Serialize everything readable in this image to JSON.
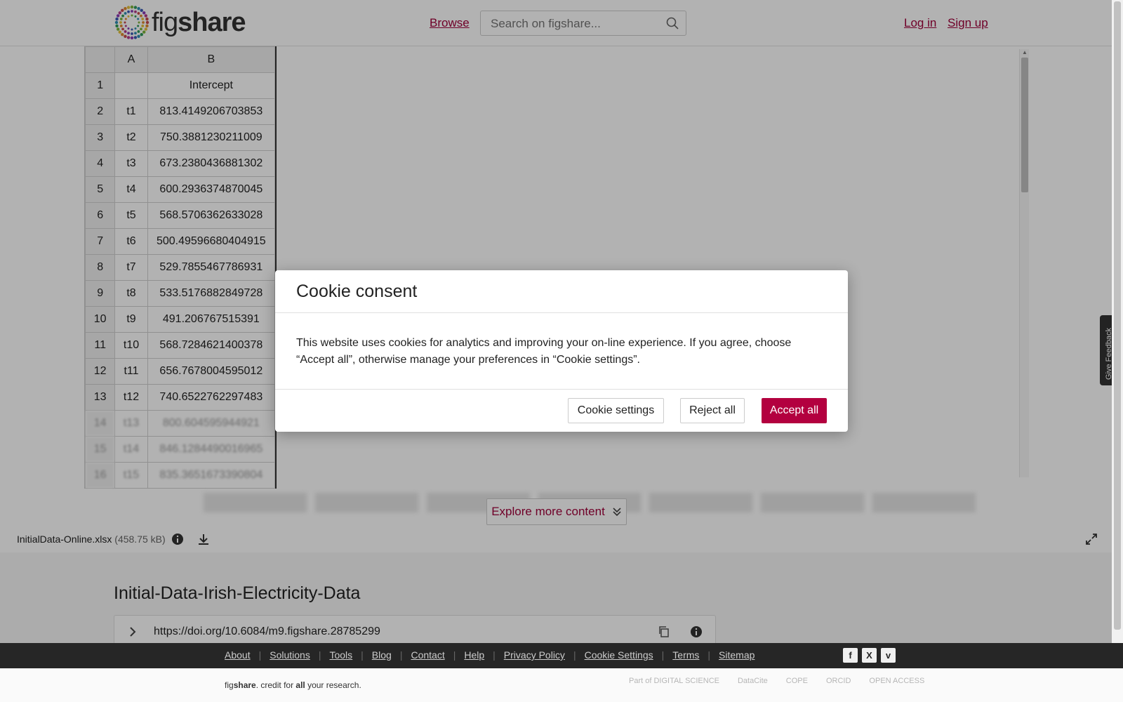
{
  "header": {
    "logo_text_light": "fig",
    "logo_text_bold": "share",
    "browse": "Browse",
    "search_placeholder": "Search on figshare...",
    "login": "Log in",
    "signup": "Sign up"
  },
  "sheet": {
    "col_headers": [
      "",
      "A",
      "B"
    ],
    "rows": [
      [
        "1",
        "",
        "Intercept"
      ],
      [
        "2",
        "t1",
        "813.4149206703853"
      ],
      [
        "3",
        "t2",
        "750.3881230211009"
      ],
      [
        "4",
        "t3",
        "673.2380436881302"
      ],
      [
        "5",
        "t4",
        "600.2936374870045"
      ],
      [
        "6",
        "t5",
        "568.5706362633028"
      ],
      [
        "7",
        "t6",
        "500.49596680404915"
      ],
      [
        "8",
        "t7",
        "529.7855467786931"
      ],
      [
        "9",
        "t8",
        "533.5176882849728"
      ],
      [
        "10",
        "t9",
        "491.206767515391"
      ],
      [
        "11",
        "t10",
        "568.7284621400378"
      ],
      [
        "12",
        "t11",
        "656.7678004595012"
      ],
      [
        "13",
        "t12",
        "740.6522762297483"
      ],
      [
        "14",
        "t13",
        "800.604595944921"
      ],
      [
        "15",
        "t14",
        "846.1284490016965"
      ],
      [
        "16",
        "t15",
        "835.3651673390804"
      ]
    ]
  },
  "explore_label": "Explore more content",
  "file": {
    "name": "InitialData-Online.xlsx",
    "size": "(458.75 kB)"
  },
  "item": {
    "title": "Initial-Data-Irish-Electricity-Data",
    "doi": "https://doi.org/10.6084/m9.figshare.28785299"
  },
  "footer": {
    "links": [
      "About",
      "Solutions",
      "Tools",
      "Blog",
      "Contact",
      "Help",
      "Privacy Policy",
      "Cookie Settings",
      "Terms",
      "Sitemap"
    ],
    "social": [
      "f",
      "X",
      "v"
    ],
    "tagline_a": "fig",
    "tagline_b": "share",
    "tagline_c": ". credit for ",
    "tagline_d": "all",
    "tagline_e": " your research.",
    "partners": [
      "Part of DIGITAL SCIENCE",
      "DataCite",
      "COPE",
      "ORCID",
      "OPEN ACCESS"
    ]
  },
  "feedback": "Give Feedback",
  "modal": {
    "title": "Cookie consent",
    "body": "This website uses cookies for analytics and improving your on-line experience. If you agree, choose “Accept all”, otherwise manage your preferences in “Cookie settings”.",
    "settings": "Cookie settings",
    "reject": "Reject all",
    "accept": "Accept all"
  },
  "colors": {
    "accent": "#a0003a",
    "accept_bg": "#b3003f"
  }
}
